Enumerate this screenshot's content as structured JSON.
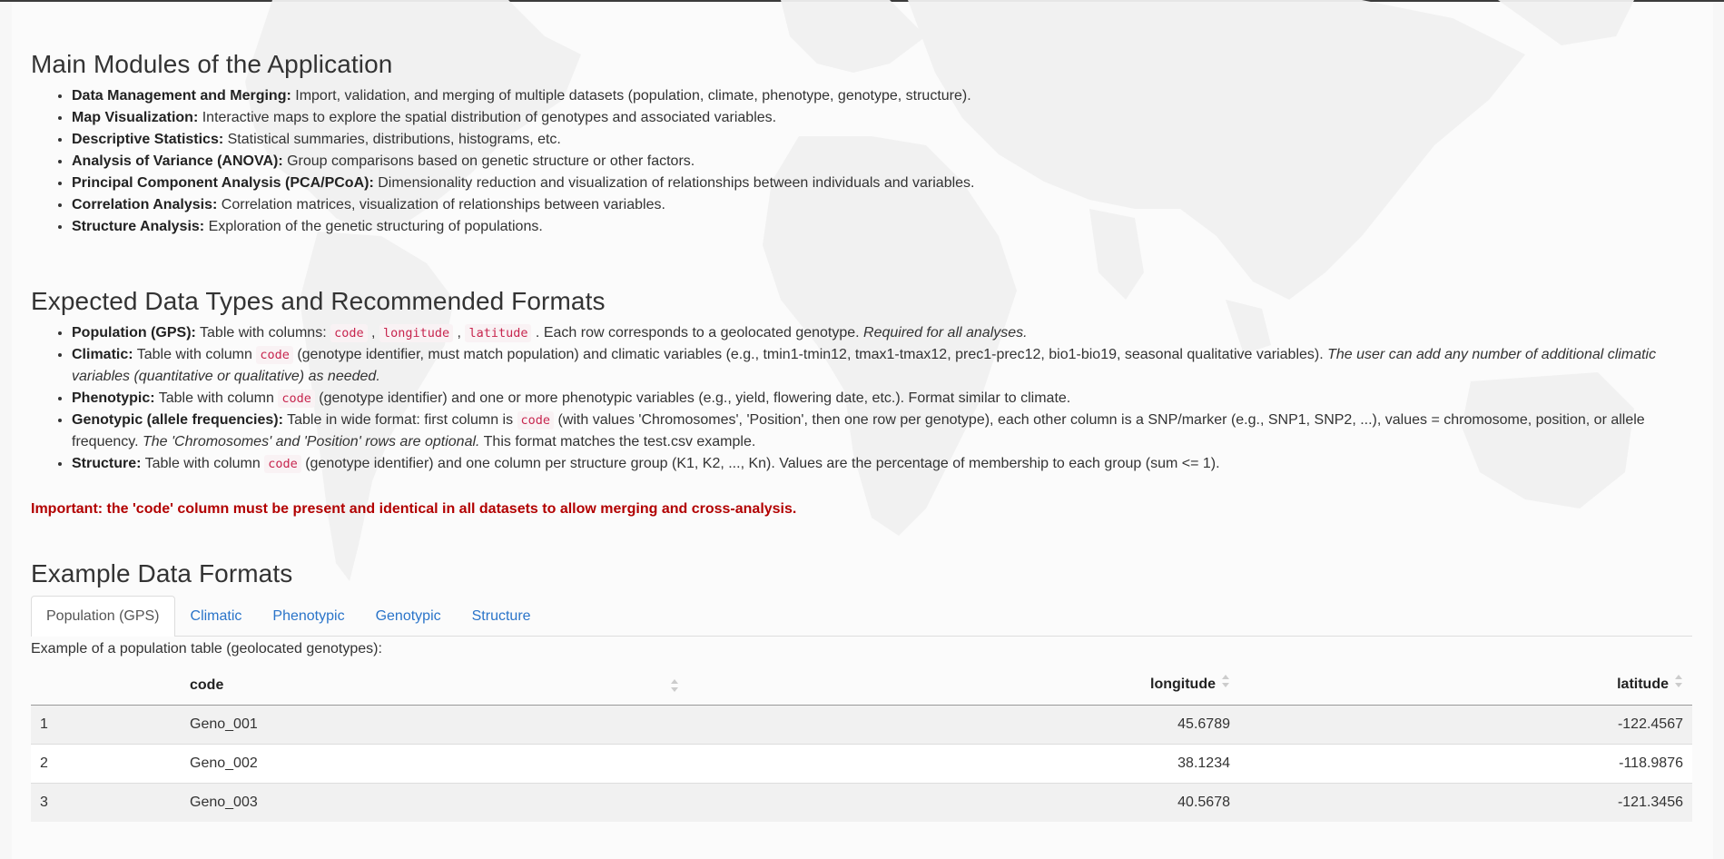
{
  "modules": {
    "title": "Main Modules of the Application",
    "items": [
      {
        "label": "Data Management and Merging:",
        "text": " Import, validation, and merging of multiple datasets (population, climate, phenotype, genotype, structure)."
      },
      {
        "label": "Map Visualization:",
        "text": " Interactive maps to explore the spatial distribution of genotypes and associated variables."
      },
      {
        "label": "Descriptive Statistics:",
        "text": " Statistical summaries, distributions, histograms, etc."
      },
      {
        "label": "Analysis of Variance (ANOVA):",
        "text": " Group comparisons based on genetic structure or other factors."
      },
      {
        "label": "Principal Component Analysis (PCA/PCoA):",
        "text": " Dimensionality reduction and visualization of relationships between individuals and variables."
      },
      {
        "label": "Correlation Analysis:",
        "text": " Correlation matrices, visualization of relationships between variables."
      },
      {
        "label": "Structure Analysis:",
        "text": " Exploration of the genetic structuring of populations."
      }
    ]
  },
  "datatypes": {
    "title": "Expected Data Types and Recommended Formats",
    "population": {
      "label": "Population (GPS):",
      "t1": " Table with columns: ",
      "c1": "code",
      "sep1": " , ",
      "c2": "longitude",
      "sep2": " , ",
      "c3": "latitude",
      "t2": " . Each row corresponds to a geolocated genotype. ",
      "em": "Required for all analyses."
    },
    "climatic": {
      "label": "Climatic:",
      "t1": " Table with column ",
      "c1": "code",
      "t2": " (genotype identifier, must match population) and climatic variables (e.g., tmin1-tmin12, tmax1-tmax12, prec1-prec12, bio1-bio19, seasonal qualitative variables). ",
      "em": "The user can add any number of additional climatic variables (quantitative or qualitative) as needed."
    },
    "phenotypic": {
      "label": "Phenotypic:",
      "t1": " Table with column ",
      "c1": "code",
      "t2": " (genotype identifier) and one or more phenotypic variables (e.g., yield, flowering date, etc.). Format similar to climate."
    },
    "genotypic": {
      "label": "Genotypic (allele frequencies):",
      "t1": " Table in wide format: first column is ",
      "c1": "code",
      "t2": " (with values 'Chromosomes', 'Position', then one row per genotype), each other column is a SNP/marker (e.g., SNP1, SNP2, ...), values = chromosome, position, or allele frequency. ",
      "em": "The 'Chromosomes' and 'Position' rows are optional.",
      "t3": " This format matches the test.csv example."
    },
    "structure": {
      "label": "Structure:",
      "t1": " Table with column ",
      "c1": "code",
      "t2": " (genotype identifier) and one column per structure group (K1, K2, ..., Kn). Values are the percentage of membership to each group (sum <= 1)."
    }
  },
  "important": "Important: the 'code' column must be present and identical in all datasets to allow merging and cross-analysis.",
  "examples": {
    "title": "Example Data Formats",
    "tabs": [
      "Population (GPS)",
      "Climatic",
      "Phenotypic",
      "Genotypic",
      "Structure"
    ],
    "active_tab": "Population (GPS)",
    "caption": "Example of a population table (geolocated genotypes):",
    "table": {
      "headers": [
        "",
        "code",
        "longitude",
        "latitude"
      ],
      "rows": [
        [
          "1",
          "Geno_001",
          "45.6789",
          "-122.4567"
        ],
        [
          "2",
          "Geno_002",
          "38.1234",
          "-118.9876"
        ],
        [
          "3",
          "Geno_003",
          "40.5678",
          "-121.3456"
        ]
      ]
    }
  },
  "colors": {
    "link": "#2a74c9",
    "important": "#b20000",
    "code": "#c7254e"
  }
}
